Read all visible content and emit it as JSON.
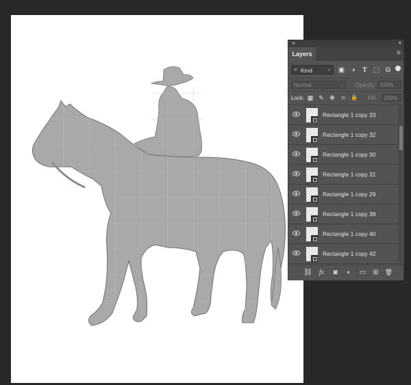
{
  "panel": {
    "close_glyph": "×",
    "collapse_glyph": "‹‹",
    "tab_label": "Layers",
    "menu_glyph": "≡",
    "filter": {
      "kind_label": "Kind",
      "icons": [
        "image-filter-icon",
        "adjustment-filter-icon",
        "type-filter-icon",
        "shape-filter-icon",
        "smart-object-filter-icon"
      ],
      "glyphs": [
        "▣",
        "◑",
        "T",
        "⬚",
        "⧉"
      ]
    },
    "blend_mode": "Normal",
    "opacity_label": "Opacity:",
    "opacity_value": "100%",
    "lock_label": "Lock:",
    "lock_icons": [
      "lock-transparent-icon",
      "lock-paint-icon",
      "lock-move-icon",
      "lock-artboard-icon",
      "lock-all-icon"
    ],
    "lock_glyphs": [
      "▦",
      "✎",
      "✥",
      "⌗",
      "🔒"
    ],
    "fill_label": "Fill:",
    "fill_value": "100%",
    "layers": [
      {
        "name": "Rectangle 1 copy 33"
      },
      {
        "name": "Rectangle 1 copy 32"
      },
      {
        "name": "Rectangle 1 copy 30"
      },
      {
        "name": "Rectangle 1 copy 31"
      },
      {
        "name": "Rectangle 1 copy 29"
      },
      {
        "name": "Rectangle 1 copy 38"
      },
      {
        "name": "Rectangle 1 copy 40"
      },
      {
        "name": "Rectangle 1 copy 42"
      }
    ],
    "bottom_icons": [
      "link-layers-icon",
      "fx-icon",
      "add-mask-icon",
      "adjustment-layer-icon",
      "new-group-icon",
      "new-layer-icon",
      "delete-layer-icon"
    ],
    "bottom_glyphs": [
      "⛓",
      "fx",
      "◙",
      "◐",
      "▭",
      "⊞",
      "🗑"
    ]
  },
  "colors": {
    "silhouette": "#a9a9a9",
    "canvas_bg": "#ffffff",
    "workspace_bg": "#282828",
    "panel_bg": "#535353"
  }
}
